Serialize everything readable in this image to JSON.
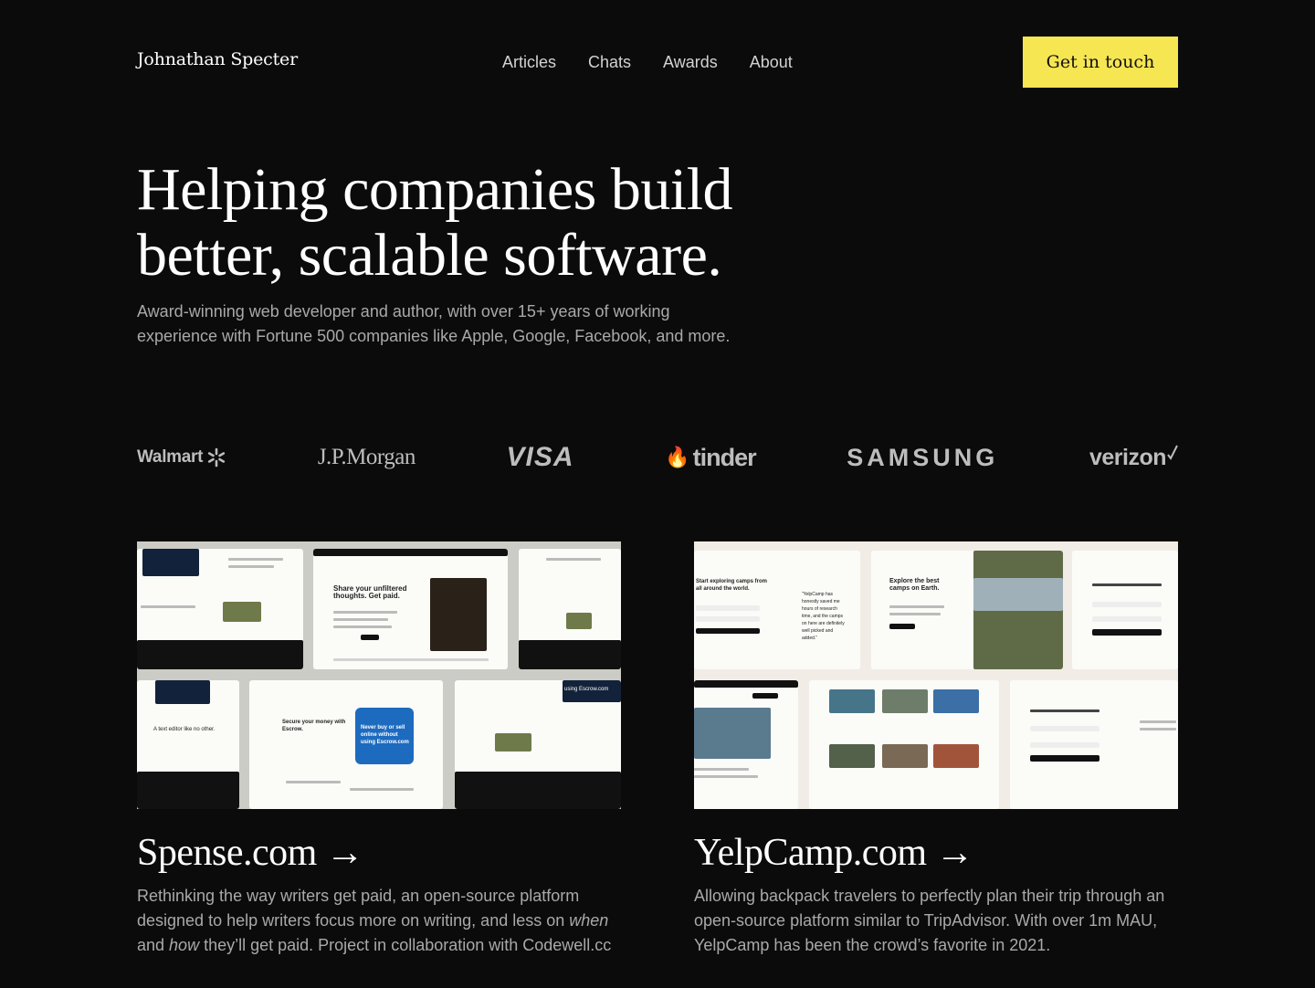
{
  "header": {
    "brand": "Johnathan Specter",
    "nav": [
      "Articles",
      "Chats",
      "Awards",
      "About"
    ],
    "cta": "Get in touch"
  },
  "hero": {
    "title_line1": "Helping companies build",
    "title_line2": "better, scalable software.",
    "subtitle": "Award-winning web developer and author, with over 15+ years of working experience with Fortune 500 companies like Apple, Google, Facebook, and more."
  },
  "logos": [
    "Walmart",
    "J.P.Morgan",
    "VISA",
    "tinder",
    "SAMSUNG",
    "verizon"
  ],
  "projects": [
    {
      "title": "Spense.com →",
      "desc_pre": "Rethinking the way writers get paid, an open-source platform designed to help writers focus more on writing, and less on ",
      "desc_em1": "when",
      "desc_mid": " and ",
      "desc_em2": "how",
      "desc_post": " they’ll get paid. Project in collaboration with Codewell.cc",
      "mock": {
        "headline": "Share your unfiltered thoughts. Get paid.",
        "secure": "Secure your money with Escrow.",
        "never": "Never buy or sell online without using Escrow.com",
        "editor": "A text editor like no other.",
        "escrow": "using Escrow.com"
      }
    },
    {
      "title": "YelpCamp.com →",
      "desc": "Allowing backpack travelers to perfectly plan their trip through an open-source platform similar to TripAdvisor. With over 1m MAU, YelpCamp has been the crowd’s favorite in 2021.",
      "mock": {
        "explore": "Explore the best camps on Earth.",
        "start": "Start exploring camps from all around the world.",
        "quote": "“YelpCamp has honestly saved me hours of research time, and the camps on here are definitely well picked and added.”"
      }
    }
  ]
}
